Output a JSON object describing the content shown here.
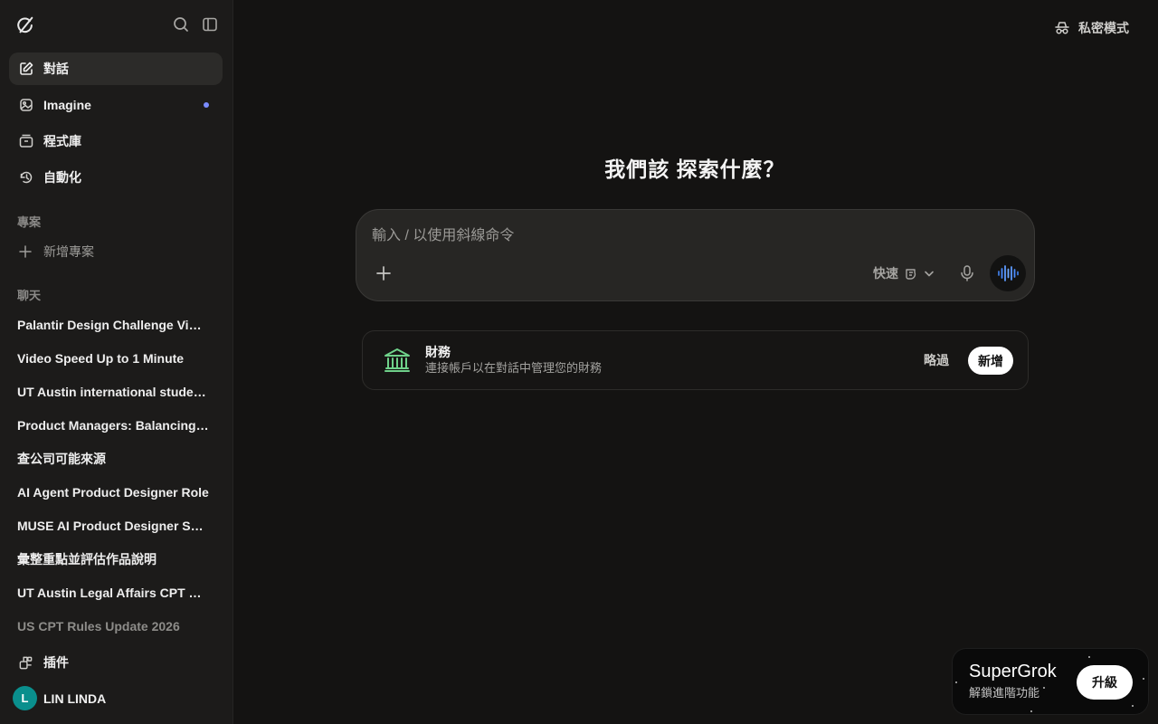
{
  "sidebar": {
    "logo_icon": "grok-logo-icon",
    "top_icons": [
      "search-icon",
      "sidebar-toggle-icon"
    ],
    "nav": [
      {
        "label": "對話",
        "icon": "edit-icon",
        "active": true
      },
      {
        "label": "Imagine",
        "icon": "image-icon",
        "badge_dot": true
      },
      {
        "label": "程式庫",
        "icon": "library-icon"
      },
      {
        "label": "自動化",
        "icon": "automation-icon"
      }
    ],
    "projects_title": "專案",
    "new_project_label": "新增專案",
    "chats_title": "聊天",
    "chats": [
      "Palantir Design Challenge Video Speed Up",
      "Video Speed Up to 1 Minute",
      "UT Austin international student CPT",
      "Product Managers: Balancing Priorities",
      "查公司可能來源",
      "AI Agent Product Designer Role",
      "MUSE AI Product Designer Salary",
      "彙整重點並評估作品說明",
      "UT Austin Legal Affairs CPT Policy",
      "US CPT Rules Update 2026"
    ],
    "plugins_label": "插件",
    "user": {
      "initial": "L",
      "name": "LIN LINDA",
      "avatar_color": "#0a8f8d"
    }
  },
  "header": {
    "private_mode_label": "私密模式",
    "private_mode_icon": "incognito-icon"
  },
  "main": {
    "headline": "我們該 探索什麼？",
    "composer": {
      "placeholder": "輸入 / 以使用斜線命令",
      "value": "",
      "model_label": "快速",
      "model_icon": "fast-mode-icon"
    },
    "finance_card": {
      "title": "財務",
      "description": "連接帳戶以在對話中管理您的財務",
      "skip_label": "略過",
      "add_label": "新增",
      "icon_color": "#6fd18a"
    }
  },
  "promo": {
    "title": "SuperGrok",
    "subtitle": "解鎖進階功能",
    "button_label": "升級"
  },
  "colors": {
    "background": "#141312",
    "sidebar": "#1c1b1a",
    "accent_dot": "#7b8cff",
    "voice_accent": "#4a8cff"
  }
}
